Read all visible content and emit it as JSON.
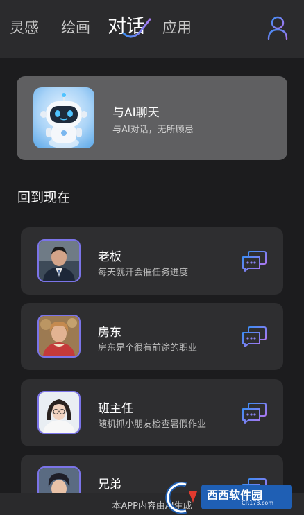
{
  "nav": {
    "tabs": [
      {
        "label": "灵感"
      },
      {
        "label": "绘画"
      },
      {
        "label": "对话"
      },
      {
        "label": "应用"
      }
    ],
    "active_tab": "对话",
    "user_icon": "user-icon",
    "accent": "#7b74e8"
  },
  "hero": {
    "title": "与AI聊天",
    "subtitle": "与AI对话，无所顾忌",
    "avatar_icon": "robot-avatar"
  },
  "section": {
    "title": "回到现在"
  },
  "roles": [
    {
      "name": "老板",
      "desc": "每天就开会催任务进度",
      "avatar": "boss-portrait"
    },
    {
      "name": "房东",
      "desc": "房东是个很有前途的职业",
      "avatar": "landlady-portrait"
    },
    {
      "name": "班主任",
      "desc": "随机抓小朋友检查暑假作业",
      "avatar": "teacher-portrait"
    },
    {
      "name": "兄弟",
      "desc": "",
      "avatar": "brother-portrait"
    }
  ],
  "footer": {
    "text": "本APP内容由AI生成"
  },
  "watermark": {
    "brand": "西西软件园",
    "url": "CR173.com"
  }
}
